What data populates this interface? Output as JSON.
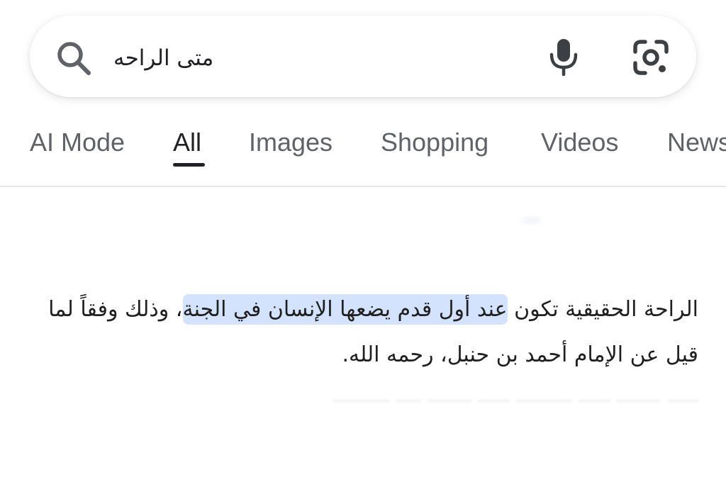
{
  "search": {
    "query": "متى الراحه",
    "search_icon": "search-icon",
    "mic_icon": "mic-icon",
    "lens_icon": "google-lens-icon"
  },
  "tabs": [
    {
      "label": "AI Mode"
    },
    {
      "label": "All",
      "active": true
    },
    {
      "label": "Images"
    },
    {
      "label": "Shopping"
    },
    {
      "label": "Videos"
    },
    {
      "label": "News"
    }
  ],
  "answer": {
    "part1": "الراحة الحقيقية تكون ",
    "highlight": "عند أول قدم يضعها الإنسان في الجنة",
    "part2": "، وذلك وفقاً لما قيل عن الإمام أحمد بن حنبل، رحمه الله."
  },
  "colors": {
    "highlight": "#d3e3fd",
    "text": "#1f1f1f",
    "tab_inactive": "#5f6368",
    "tab_active": "#202124"
  }
}
